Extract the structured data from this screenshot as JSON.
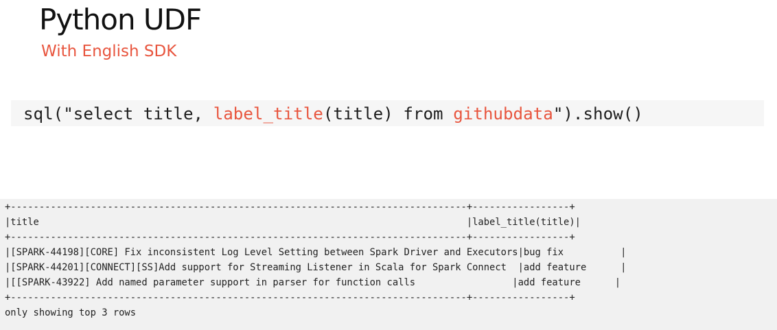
{
  "slide": {
    "title": "Python UDF",
    "subtitle": "With English SDK"
  },
  "code": {
    "segments": [
      {
        "text": "sql(\"select title, ",
        "highlight": false
      },
      {
        "text": "label_title",
        "highlight": true
      },
      {
        "text": "(title) from ",
        "highlight": false
      },
      {
        "text": "githubdata",
        "highlight": true
      },
      {
        "text": "\").show()",
        "highlight": false
      }
    ]
  },
  "output": {
    "lines": {
      "border_top": "+--------------------------------------------------------------------------------+-----------------+",
      "header": "|title                                                                           |label_title(title)|",
      "border_mid": "+--------------------------------------------------------------------------------+-----------------+",
      "row_1": "|[SPARK-44198][CORE] Fix inconsistent Log Level Setting between Spark Driver and Executors|bug fix          |",
      "row_2": "|[SPARK-44201][CONNECT][SS]Add support for Streaming Listener in Scala for Spark Connect  |add feature      |",
      "row_3": "|[[SPARK-43922] Add named parameter support in parser for function calls                 |add feature      |",
      "border_bottom": "+--------------------------------------------------------------------------------+-----------------+",
      "footer": "only showing top 3 rows"
    }
  },
  "colors": {
    "accent": "#e8553e",
    "text": "#111111",
    "code_band": "#f6f6f6",
    "output_bg": "#f1f1f1"
  }
}
